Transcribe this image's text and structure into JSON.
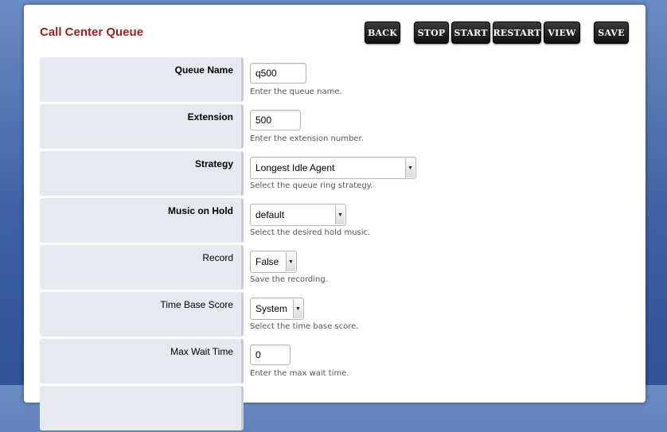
{
  "page": {
    "title": "Call Center Queue"
  },
  "toolbar": {
    "back": "BACK",
    "stop": "STOP",
    "start": "START",
    "restart": "RESTART",
    "view": "VIEW",
    "save": "SAVE"
  },
  "fields": {
    "queue_name": {
      "label": "Queue Name",
      "value": "q500",
      "description": "Enter the queue name."
    },
    "extension": {
      "label": "Extension",
      "value": "500",
      "description": "Enter the extension number."
    },
    "strategy": {
      "label": "Strategy",
      "value": "Longest Idle Agent",
      "description": "Select the queue ring strategy."
    },
    "music_on_hold": {
      "label": "Music on Hold",
      "value": "default",
      "description": "Select the desired hold music."
    },
    "record": {
      "label": "Record",
      "value": "False",
      "description": "Save the recording."
    },
    "time_base_score": {
      "label": "Time Base Score",
      "value": "System",
      "description": "Select the time base score."
    },
    "max_wait_time": {
      "label": "Max Wait Time",
      "value": "0",
      "description": "Enter the max wait time."
    }
  },
  "icons": {
    "select_arrow": "chevron-down-icon"
  },
  "colors": {
    "title": "#952424",
    "background": "#3d63a6",
    "label_cell": "#e5e9f0"
  }
}
